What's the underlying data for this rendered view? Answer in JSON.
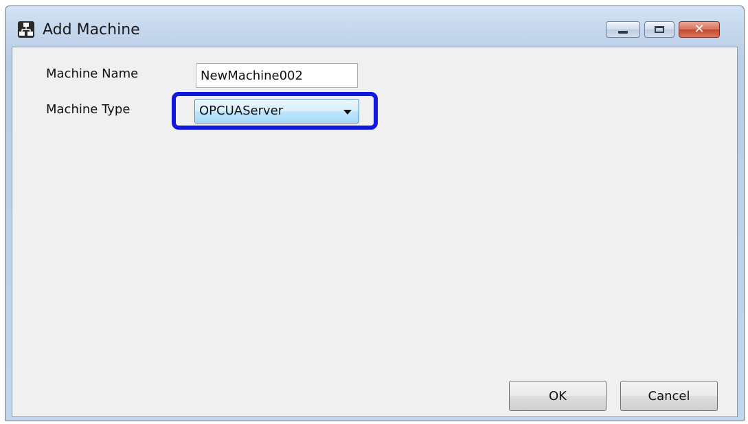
{
  "window": {
    "title": "Add Machine",
    "close_glyph": "✕",
    "icon": "network-machines-icon"
  },
  "form": {
    "machine_name_label": "Machine Name",
    "machine_name_value": "NewMachine002",
    "machine_type_label": "Machine Type",
    "machine_type_value": "OPCUAServer"
  },
  "buttons": {
    "ok_label": "OK",
    "cancel_label": "Cancel"
  },
  "colors": {
    "highlight": "#1018e0",
    "close_button": "#c3472f"
  }
}
